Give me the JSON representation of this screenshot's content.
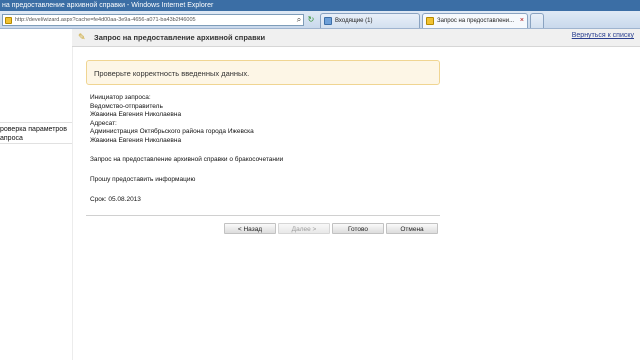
{
  "window": {
    "title": "на предоставление архивной справки - Windows Internet Explorer"
  },
  "browser": {
    "address": "http://devel/wizard.aspx?cache=fe4d00aa-3e9a-4656-a071-ba43b2f46005",
    "tabs": [
      {
        "label": "Входящие (1)",
        "active": false,
        "icon": "inbox-icon"
      },
      {
        "label": "Запрос на предоставлени...",
        "active": true,
        "icon": "page-icon"
      }
    ],
    "tab_close_symbol": "×"
  },
  "sidebar": {
    "items": [
      {
        "label": "роверка параметров\nапроса"
      }
    ]
  },
  "header": {
    "title": "Запрос на предоставление архивной справки",
    "back_link": "Вернуться к списку"
  },
  "notice": {
    "text": "Проверьте корректность введенных данных."
  },
  "details": {
    "initiator_heading": "Инициатор запроса:",
    "sender_org": "Ведомство-отправитель",
    "sender_person": "Жвакина Евгения Николаевна",
    "addressee_heading": "Адресат:",
    "addressee_org": "Администрация Октябрьского района города Ижевска",
    "addressee_person": "Жвакина Евгения Николаевна",
    "subject": "Запрос на предоставление архивной справки о бракосочетании",
    "request_text": "Прошу предоставить информацию",
    "deadline": "Срок: 05.08.2013"
  },
  "buttons": {
    "back": "< Назад",
    "next": "Далее >",
    "done": "Готово",
    "cancel": "Отмена"
  }
}
